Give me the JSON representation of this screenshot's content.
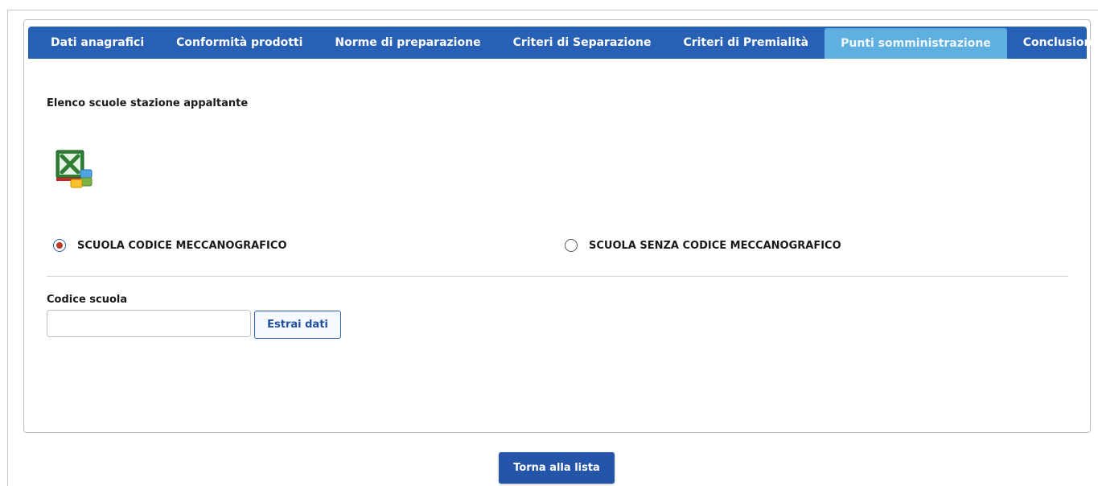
{
  "tabs": [
    {
      "label": "Dati anagrafici"
    },
    {
      "label": "Conformità prodotti"
    },
    {
      "label": "Norme di preparazione"
    },
    {
      "label": "Criteri di Separazione"
    },
    {
      "label": "Criteri di Premialità"
    },
    {
      "label": "Punti somministrazione",
      "active": true
    },
    {
      "label": "Conclusione"
    }
  ],
  "section": {
    "title": "Elenco scuole stazione appaltante",
    "export_icon": "excel-icon"
  },
  "school_type": {
    "selected": "SCUOLA CODICE MECCANOGRAFICO",
    "options": [
      {
        "label": "SCUOLA CODICE MECCANOGRAFICO",
        "checked": true
      },
      {
        "label": "SCUOLA SENZA CODICE MECCANOGRAFICO",
        "checked": false
      }
    ]
  },
  "codice": {
    "label": "Codice scuola",
    "value": "",
    "placeholder": "",
    "extract_label": "Estrai dati"
  },
  "footer": {
    "back_label": "Torna alla lista"
  },
  "colors": {
    "tabbar": "#2860b5",
    "active_tab": "#5fb0e0",
    "primary_button": "#2455a8"
  }
}
